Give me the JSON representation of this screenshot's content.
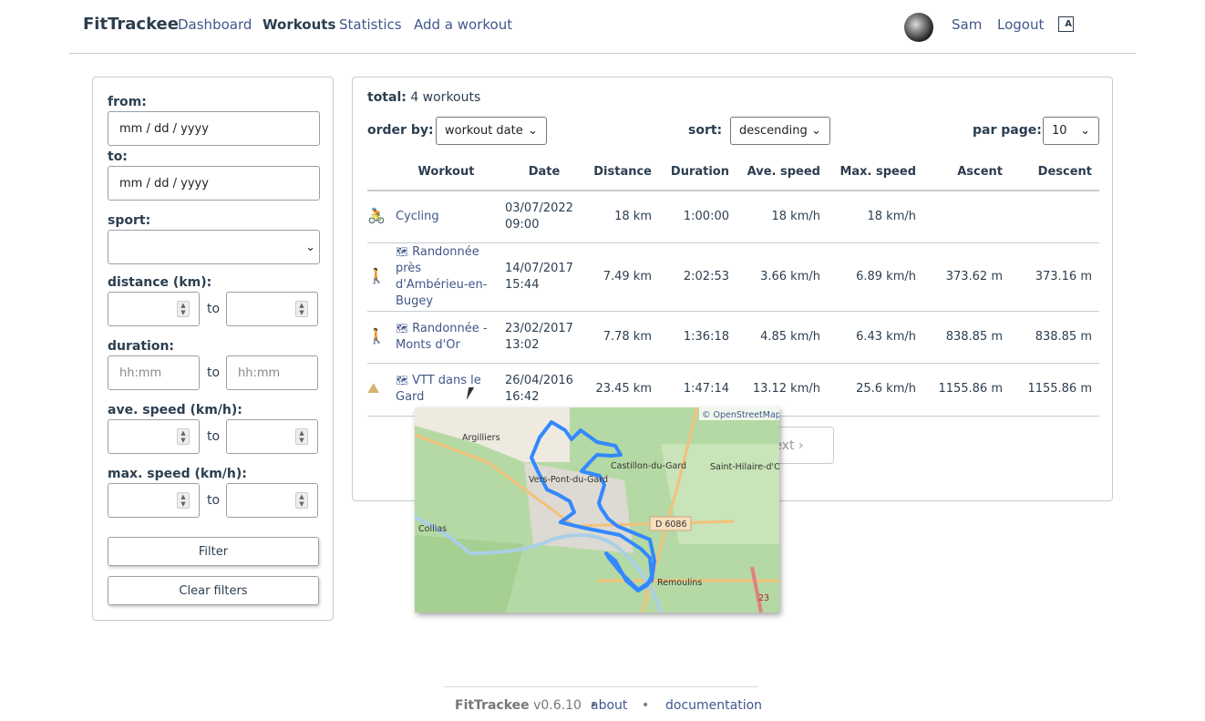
{
  "header": {
    "brand": "FitTrackee",
    "nav": [
      "Dashboard",
      "Workouts",
      "Statistics",
      "Add a workout"
    ],
    "user": "Sam",
    "logout": "Logout",
    "lang_icon": "language-icon"
  },
  "filters": {
    "from_label": "from:",
    "from_placeholder": "mm / dd / yyyy",
    "to_label": "to:",
    "to_placeholder": "mm / dd / yyyy",
    "sport_label": "sport:",
    "sport_value": "",
    "distance_label": "distance (km):",
    "duration_label": "duration:",
    "duration_placeholder": "hh:mm",
    "ave_speed_label": "ave. speed (km/h):",
    "max_speed_label": "max. speed (km/h):",
    "to_word": "to",
    "filter_button": "Filter",
    "clear_button": "Clear filters"
  },
  "main": {
    "total_label": "total:",
    "total_value": "4 workouts",
    "order_by_label": "order by:",
    "order_by_value": "workout date",
    "sort_label": "sort:",
    "sort_value": "descending",
    "per_page_label": "par page:",
    "per_page_value": "10",
    "next_label": "next",
    "columns": [
      "",
      "Workout",
      "Date",
      "Distance",
      "Duration",
      "Ave. speed",
      "Max. speed",
      "Ascent",
      "Descent"
    ],
    "rows": [
      {
        "sport": "cycling",
        "icon_color": "#4c9792",
        "title": "Cycling",
        "has_map": false,
        "date": "03/07/2022",
        "time": "09:00",
        "distance": "18 km",
        "duration": "1:00:00",
        "ave": "18 km/h",
        "max": "18 km/h",
        "ascent": "",
        "descent": ""
      },
      {
        "sport": "hiking",
        "icon_color": "#bb757c",
        "title": "Randonnée près d'Ambérieu-en-Bugey",
        "has_map": true,
        "date": "14/07/2017",
        "time": "15:44",
        "distance": "7.49 km",
        "duration": "2:02:53",
        "ave": "3.66 km/h",
        "max": "6.89 km/h",
        "ascent": "373.62 m",
        "descent": "373.16 m"
      },
      {
        "sport": "hiking",
        "icon_color": "#bb757c",
        "title": "Randonnée - Monts d'Or",
        "has_map": true,
        "date": "23/02/2017",
        "time": "13:02",
        "distance": "7.78 km",
        "duration": "1:36:18",
        "ave": "4.85 km/h",
        "max": "6.43 km/h",
        "ascent": "838.85 m",
        "descent": "838.85 m"
      },
      {
        "sport": "mountain-biking",
        "icon_color": "#d4b371",
        "title": "VTT dans le Gard",
        "has_map": true,
        "date": "26/04/2016",
        "time": "16:42",
        "distance": "23.45 km",
        "duration": "1:47:14",
        "ave": "13.12 km/h",
        "max": "25.6 km/h",
        "ascent": "1155.86 m",
        "descent": "1155.86 m"
      }
    ]
  },
  "map": {
    "attribution": "© OpenStreetMap",
    "labels": [
      "Argilliers",
      "Vers-Pont-du-Gard",
      "Castillon-du-Gard",
      "Saint-Hilaire-d'Ozilhan",
      "Collias",
      "D 6086",
      "Remoulins",
      "23"
    ],
    "track_color": "#3388ff"
  },
  "footer": {
    "brand": "FitTrackee",
    "version": "v0.6.10",
    "about": "about",
    "documentation": "documentation"
  }
}
